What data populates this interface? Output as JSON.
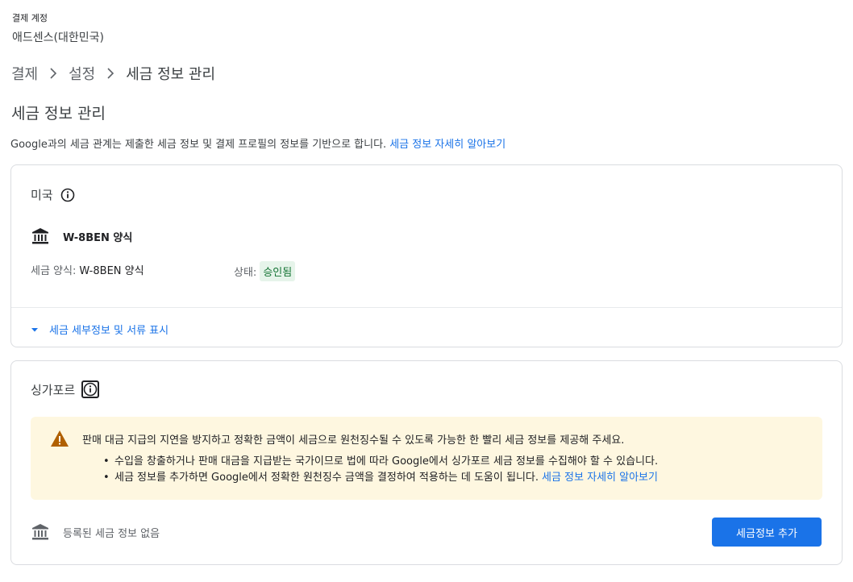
{
  "account": {
    "label": "결제 계정",
    "name": "애드센스(대한민국)"
  },
  "breadcrumb": {
    "items": [
      "결제",
      "설정"
    ],
    "current": "세금 정보 관리"
  },
  "page": {
    "title": "세금 정보 관리",
    "intro": "Google과의 세금 관계는 제출한 세금 정보 및 결제 프로필의 정보를 기반으로 합니다.",
    "intro_link": "세금 정보 자세히 알아보기"
  },
  "us_card": {
    "country": "미국",
    "form_name": "W-8BEN 양식",
    "form_type_label": "세금 양식:",
    "form_type_value": "W-8BEN 양식",
    "status_label": "상태:",
    "status_value": "승인됨",
    "expander_label": "세금 세부정보 및 서류 표시"
  },
  "sg_card": {
    "country": "싱가포르",
    "alert": {
      "main": "판매 대금 지급의 지연을 방지하고 정확한 금액이 세금으로 원천징수될 수 있도록 가능한 한 빨리 세금 정보를 제공해 주세요.",
      "bullet1": "수입을 창출하거나 판매 대금을 지급받는 국가이므로 법에 따라 Google에서 싱가포르 세금 정보를 수집해야 할 수 있습니다.",
      "bullet2": "세금 정보를 추가하면 Google에서 정확한 원천징수 금액을 결정하여 적용하는 데 도움이 됩니다.",
      "link": "세금 정보 자세히 알아보기"
    },
    "empty_text": "등록된 세금 정보 없음",
    "add_button": "세금정보 추가"
  },
  "colors": {
    "accent": "#1a73e8",
    "success_bg": "#e6f4ea",
    "success_text": "#137333",
    "warning_bg": "#fef7e0",
    "warning_icon": "#b06000"
  }
}
